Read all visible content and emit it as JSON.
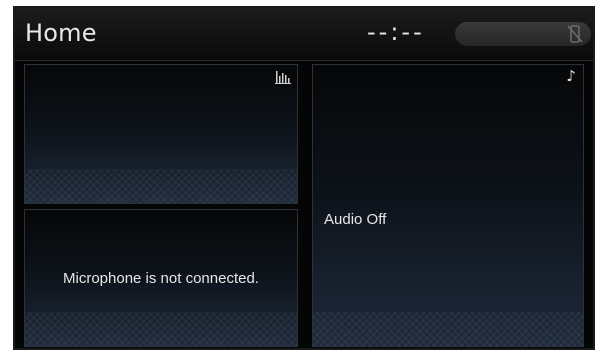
{
  "header": {
    "title": "Home",
    "clock": "--:--",
    "status_icon": "phone-disconnected-icon"
  },
  "panels": {
    "top_left": {
      "icon": "equalizer-icon"
    },
    "bottom_left": {
      "message": "Microphone is not connected."
    },
    "right": {
      "icon": "music-note-icon",
      "message": "Audio Off"
    }
  },
  "colors": {
    "background": "#050505",
    "text": "#e6e6e6",
    "panel_gradient_bottom": "#1e2a3b"
  }
}
